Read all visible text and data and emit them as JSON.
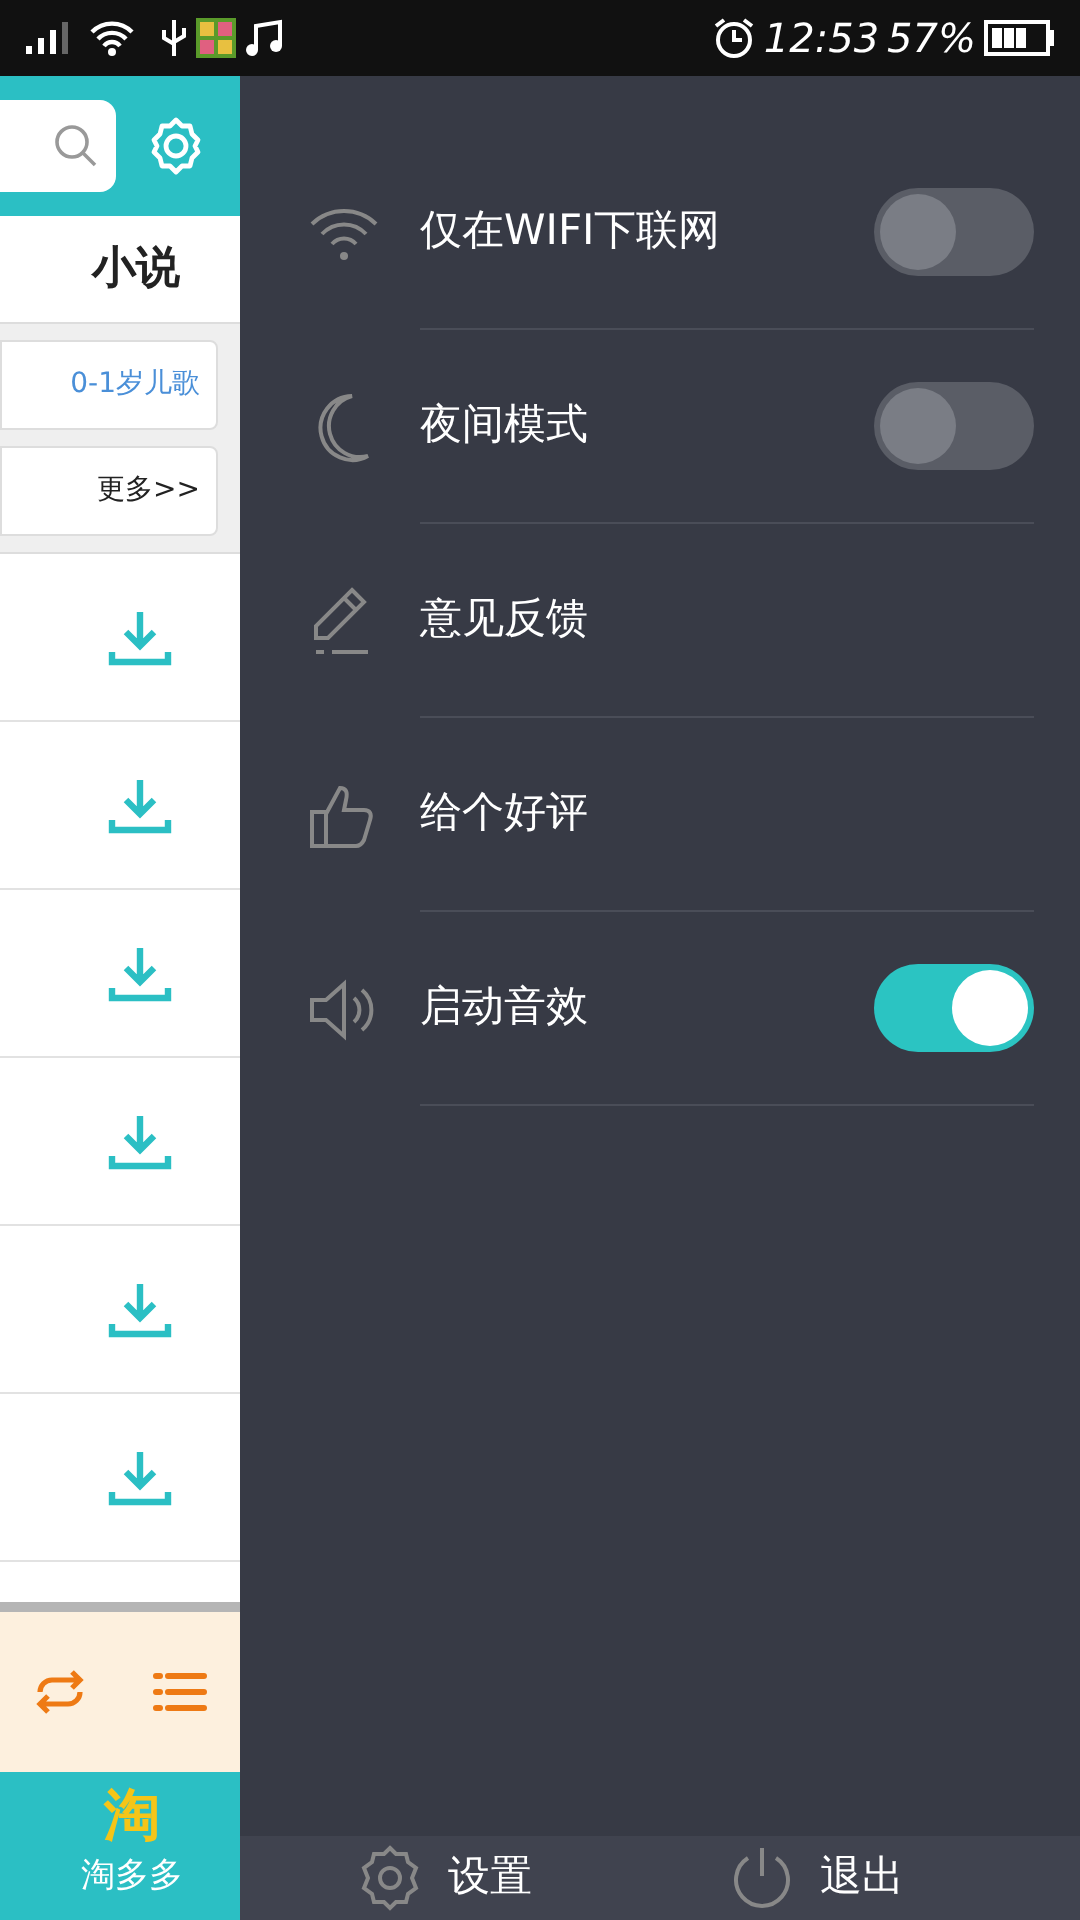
{
  "status_bar": {
    "time": "12:53",
    "battery": "57%"
  },
  "left_panel": {
    "tab": "小说",
    "tags": [
      {
        "label": "0-1岁儿歌",
        "kind": "link"
      },
      {
        "label": "更多>>",
        "kind": "more"
      }
    ],
    "rows": [
      {
        "kind": "download"
      },
      {
        "kind": "download"
      },
      {
        "kind": "download"
      },
      {
        "kind": "download"
      },
      {
        "kind": "download"
      },
      {
        "kind": "download"
      }
    ],
    "app_logo": "淘",
    "app_name": "淘多多"
  },
  "settings": [
    {
      "label": "仅在WIFI下联网",
      "kind": "toggle",
      "on": false
    },
    {
      "label": "夜间模式",
      "kind": "toggle",
      "on": false
    },
    {
      "label": "意见反馈",
      "kind": "link"
    },
    {
      "label": "给个好评",
      "kind": "link"
    },
    {
      "label": "启动音效",
      "kind": "toggle",
      "on": true
    }
  ],
  "footer": [
    {
      "label": "设置"
    },
    {
      "label": "退出"
    }
  ]
}
